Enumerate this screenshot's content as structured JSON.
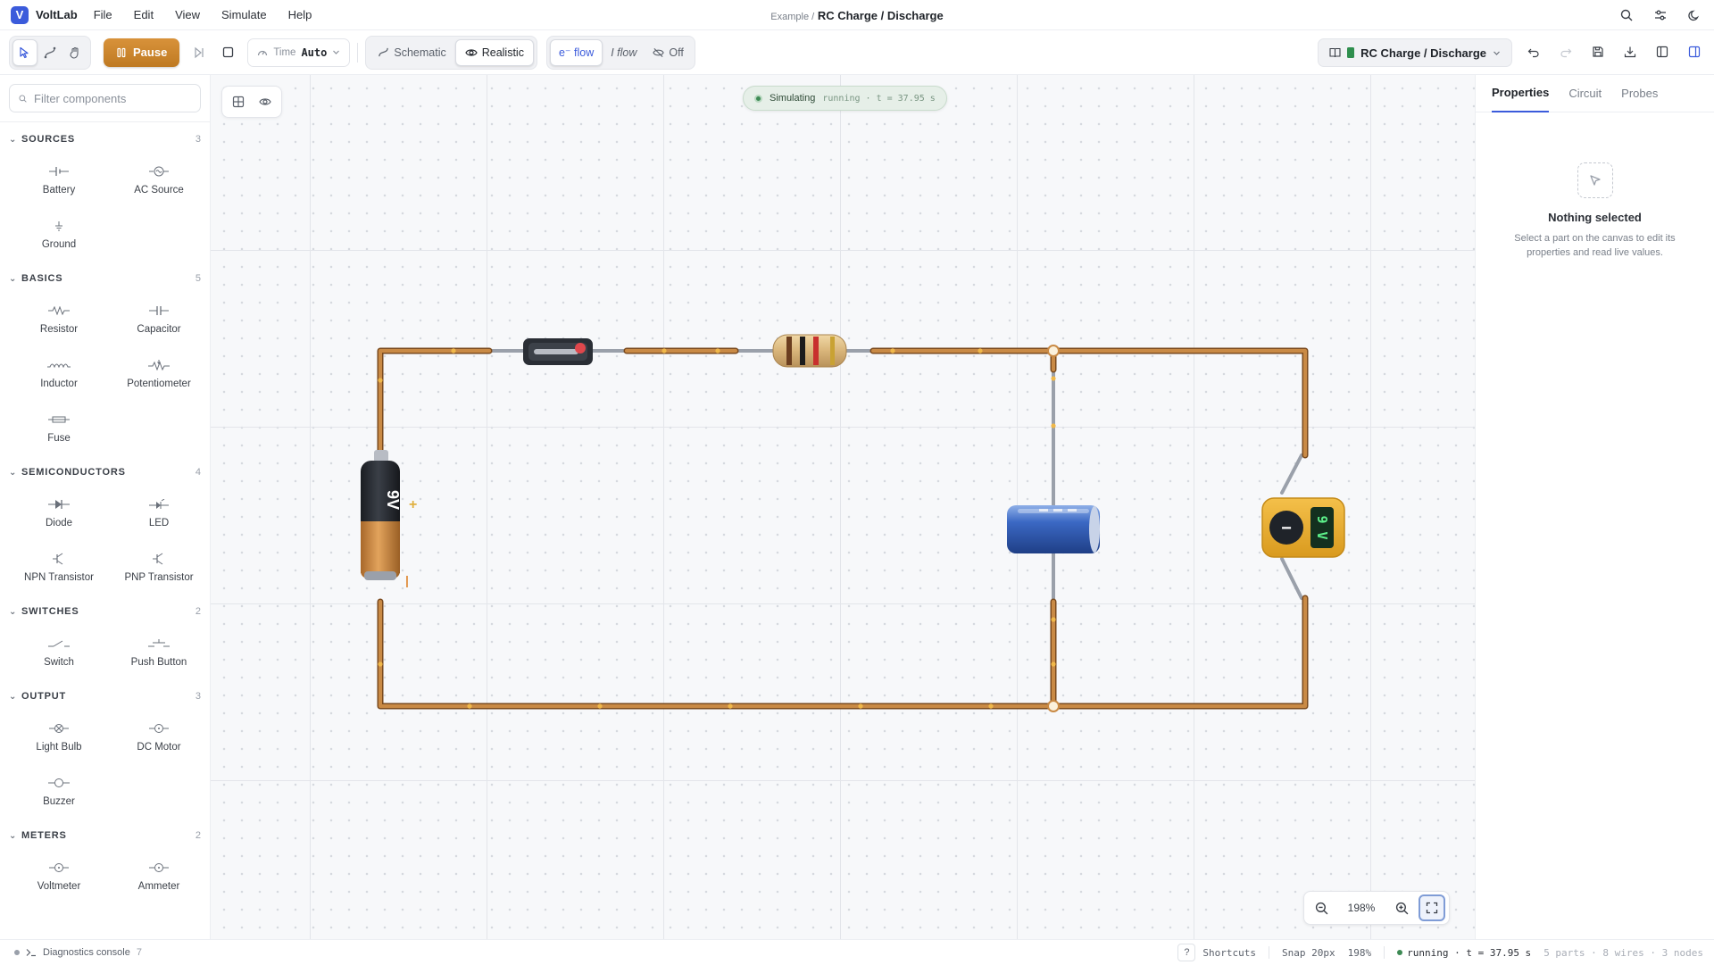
{
  "app": {
    "logo": "V",
    "name": "VoltLab"
  },
  "menu": [
    "File",
    "Edit",
    "View",
    "Simulate",
    "Help"
  ],
  "title": {
    "prefix": "Example /",
    "name": "RC Charge / Discharge"
  },
  "toolbar": {
    "pause_label": "Pause",
    "time_label": "Time",
    "time_value": "Auto",
    "mode_schematic": "Schematic",
    "mode_realistic": "Realistic",
    "flow_electron": "e⁻ flow",
    "flow_current": "I flow",
    "flow_off": "Off",
    "project_name": "RC Charge / Discharge"
  },
  "palette": {
    "filter_placeholder": "Filter components",
    "sections": [
      {
        "title": "SOURCES",
        "count": "3",
        "items": [
          "Battery",
          "AC Source",
          "Ground"
        ]
      },
      {
        "title": "BASICS",
        "count": "5",
        "items": [
          "Resistor",
          "Capacitor",
          "Inductor",
          "Potentiometer",
          "Fuse"
        ]
      },
      {
        "title": "SEMICONDUCTORS",
        "count": "4",
        "items": [
          "Diode",
          "LED",
          "NPN Transistor",
          "PNP Transistor"
        ]
      },
      {
        "title": "SWITCHES",
        "count": "2",
        "items": [
          "Switch",
          "Push Button"
        ]
      },
      {
        "title": "OUTPUT",
        "count": "3",
        "items": [
          "Light Bulb",
          "DC Motor",
          "Buzzer"
        ]
      },
      {
        "title": "METERS",
        "count": "2",
        "items": [
          "Voltmeter",
          "Ammeter"
        ]
      }
    ]
  },
  "canvas": {
    "sim_label": "Simulating",
    "sim_status": "running · t = 37.95 s",
    "battery_label": "9V",
    "battery_plus": "+",
    "battery_minus": "|",
    "meter_reading": "9 V",
    "meter_minus": "−",
    "zoom": "198%"
  },
  "inspector": {
    "tabs": [
      "Properties",
      "Circuit",
      "Probes"
    ],
    "empty_title": "Nothing selected",
    "empty_desc": "Select a part on the canvas to edit its properties and read live values."
  },
  "statusbar": {
    "diagnostics_label": "Diagnostics console",
    "diagnostics_count": "7",
    "shortcuts_key": "?",
    "shortcuts_label": "Shortcuts",
    "snap": "Snap 20px",
    "zoom": "198%",
    "running": "running · t = 37.95 s",
    "counts": "5 parts · 8 wires · 3 nodes"
  },
  "colors": {
    "accent": "#3b5bdb",
    "pause": "#c98428",
    "wire": "#b87333",
    "running": "#3d8a54"
  }
}
